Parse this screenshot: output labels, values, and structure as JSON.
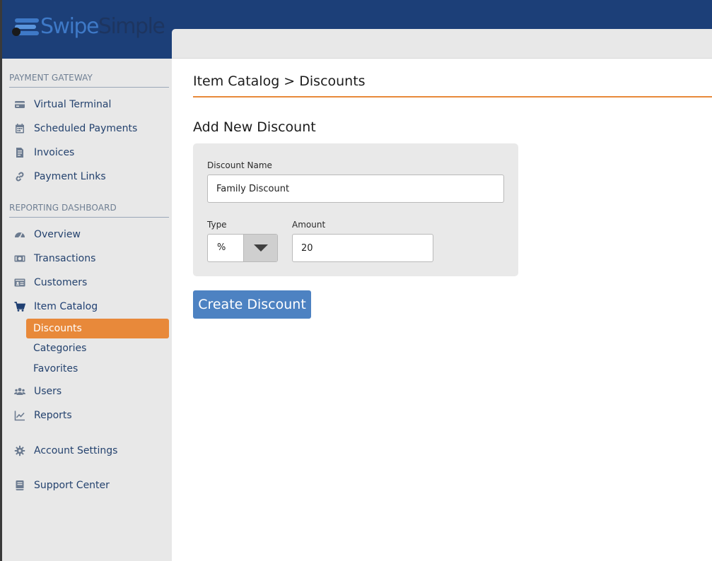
{
  "brand": {
    "logo_part1": "Swipe",
    "logo_part2": "Simple",
    "accent_color": "#e8893a",
    "header_color": "#1c3f78",
    "button_color": "#4d82c2"
  },
  "sidebar": {
    "sections": [
      {
        "title": "PAYMENT GATEWAY",
        "items": [
          {
            "label": "Virtual Terminal",
            "icon": "credit-card-icon"
          },
          {
            "label": "Scheduled Payments",
            "icon": "calendar-icon"
          },
          {
            "label": "Invoices",
            "icon": "document-icon"
          },
          {
            "label": "Payment Links",
            "icon": "link-icon"
          }
        ]
      },
      {
        "title": "REPORTING DASHBOARD",
        "items": [
          {
            "label": "Overview",
            "icon": "dashboard-icon"
          },
          {
            "label": "Transactions",
            "icon": "money-icon"
          },
          {
            "label": "Customers",
            "icon": "id-card-icon"
          },
          {
            "label": "Item Catalog",
            "icon": "cart-icon"
          },
          {
            "label": "Users",
            "icon": "users-icon"
          },
          {
            "label": "Reports",
            "icon": "chart-icon"
          }
        ]
      }
    ],
    "item_catalog_sub": [
      {
        "label": "Discounts",
        "active": true
      },
      {
        "label": "Categories",
        "active": false
      },
      {
        "label": "Favorites",
        "active": false
      }
    ],
    "bottom_items": [
      {
        "label": "Account Settings",
        "icon": "gear-icon"
      },
      {
        "label": "Support Center",
        "icon": "book-icon"
      }
    ]
  },
  "main": {
    "breadcrumb": "Item Catalog > Discounts",
    "form_title": "Add New Discount",
    "fields": {
      "name_label": "Discount Name",
      "name_value": "Family Discount",
      "type_label": "Type",
      "type_value": "%",
      "amount_label": "Amount",
      "amount_value": "20"
    },
    "create_button": "Create Discount"
  }
}
